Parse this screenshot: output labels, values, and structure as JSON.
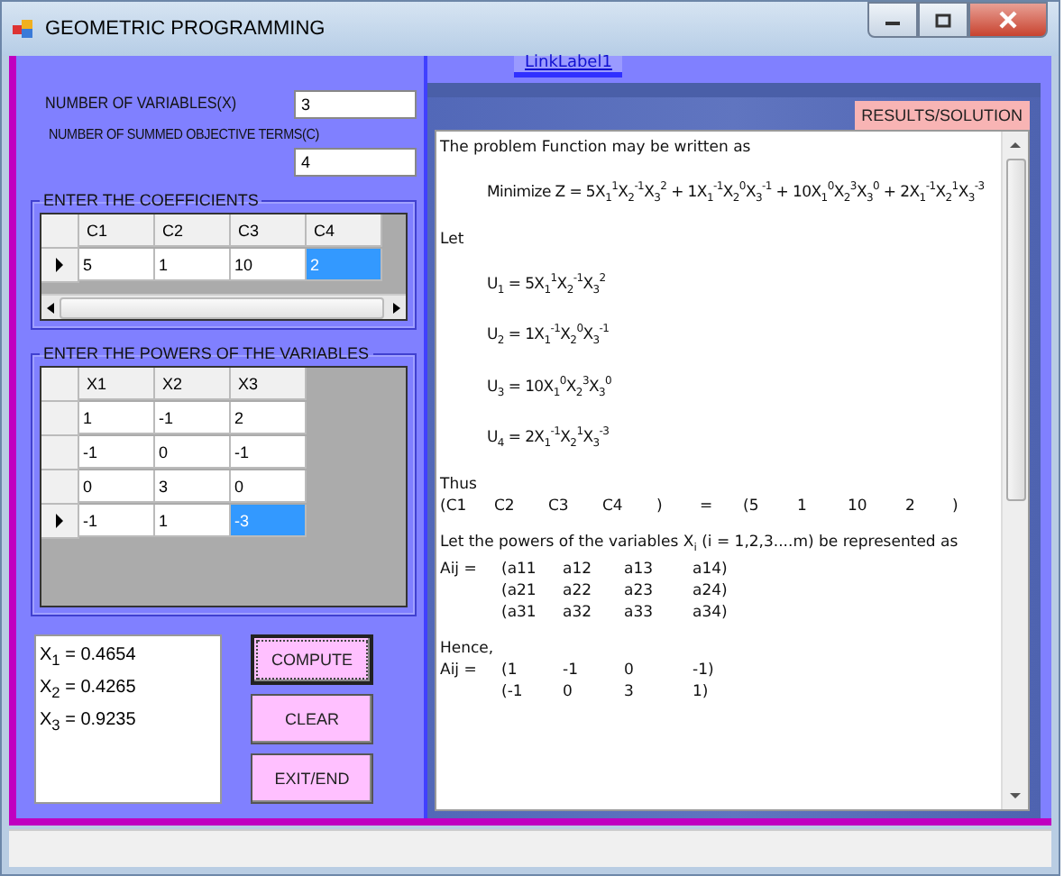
{
  "window": {
    "title": "GEOMETRIC PROGRAMMING"
  },
  "inputs": [
    {
      "label": "NUMBER OF VARIABLES(X)",
      "value": "3",
      "kind": "inline"
    },
    {
      "label": "NUMBER OF SUMMED OBJECTIVE TERMS(C)",
      "value": "4",
      "kind": "stacked"
    }
  ],
  "coefficients": {
    "title": "ENTER THE COEFFICIENTS",
    "columns": [
      "C1",
      "C2",
      "C3",
      "C4"
    ],
    "rows": [
      {
        "current": true,
        "cells": [
          {
            "value": "5",
            "selected": false
          },
          {
            "value": "1",
            "selected": false
          },
          {
            "value": "10",
            "selected": false
          },
          {
            "value": "2",
            "selected": true
          }
        ]
      }
    ]
  },
  "powers": {
    "title": "ENTER THE POWERS OF THE VARIABLES",
    "columns": [
      "X1",
      "X2",
      "X3"
    ],
    "rows": [
      {
        "current": false,
        "cells": [
          {
            "value": "1",
            "selected": false
          },
          {
            "value": "-1",
            "selected": false
          },
          {
            "value": "2",
            "selected": false
          }
        ]
      },
      {
        "current": false,
        "cells": [
          {
            "value": "-1",
            "selected": false
          },
          {
            "value": "0",
            "selected": false
          },
          {
            "value": "-1",
            "selected": false
          }
        ]
      },
      {
        "current": false,
        "cells": [
          {
            "value": "0",
            "selected": false
          },
          {
            "value": "3",
            "selected": false
          },
          {
            "value": "0",
            "selected": false
          }
        ]
      },
      {
        "current": true,
        "cells": [
          {
            "value": "-1",
            "selected": false
          },
          {
            "value": "1",
            "selected": false
          },
          {
            "value": "-3",
            "selected": true
          }
        ]
      }
    ]
  },
  "solution": [
    "X$_{1}$ = 0.4654",
    "X$_{2}$ = 0.4265",
    "X$_{3}$ = 0.9235"
  ],
  "buttons": [
    {
      "label": "COMPUTE",
      "focused": true
    },
    {
      "label": "CLEAR",
      "focused": false
    },
    {
      "label": "EXIT/END",
      "focused": false
    }
  ],
  "link": "LinkLabel1",
  "results": {
    "title": "RESULTS/SOLUTION",
    "lines": [
      {
        "kind": "para",
        "text": "The problem Function may be written as"
      },
      {
        "kind": "formula",
        "text": "Minimize Z = 5X$_{1}$$^{1}$X$_{2}$$^{-1}$X$_{3}$$^{2}$ + 1X$_{1}$$^{-1}$X$_{2}$$^{0}$X$_{3}$$^{-1}$ + 10X$_{1}$$^{0}$X$_{2}$$^{3}$X$_{3}$$^{0}$ + 2X$_{1}$$^{-1}$X$_{2}$$^{1}$X$_{3}$$^{-3}$"
      },
      {
        "kind": "para",
        "text": "Let"
      },
      {
        "kind": "formula",
        "text": "U$_{1}$ = 5X$_{1}$$^{1}$X$_{2}$$^{-1}$X$_{3}$$^{2}$"
      },
      {
        "kind": "formula",
        "text": "U$_{2}$ = 1X$_{1}$$^{-1}$X$_{2}$$^{0}$X$_{3}$$^{-1}$"
      },
      {
        "kind": "formula",
        "text": "U$_{3}$ = 10X$_{1}$$^{0}$X$_{2}$$^{3}$X$_{3}$$^{0}$"
      },
      {
        "kind": "formula",
        "text": "U$_{4}$ = 2X$_{1}$$^{-1}$X$_{2}$$^{1}$X$_{3}$$^{-3}$"
      },
      {
        "kind": "para",
        "text": "Thus"
      },
      {
        "kind": "wide",
        "cells": [
          "(C1",
          "C2",
          "C3",
          "C4",
          ")",
          "=",
          "(5",
          "1",
          "10",
          "2",
          ")"
        ]
      },
      {
        "kind": "para",
        "text": "Let the powers of the variables X$_{i}$ (i = 1,2,3....m) be represented as"
      },
      {
        "kind": "row",
        "label": "Aij =",
        "cells": [
          "(a11",
          "a12",
          "a13",
          "a14)"
        ]
      },
      {
        "kind": "row",
        "cells": [
          "(a21",
          "a22",
          "a23",
          "a24)"
        ]
      },
      {
        "kind": "row",
        "cells": [
          "(a31",
          "a32",
          "a33",
          "a34)"
        ]
      },
      {
        "kind": "para",
        "text": "Hence,"
      },
      {
        "kind": "row",
        "label": "Aij =",
        "cells": [
          "(1",
          "-1",
          "0",
          "-1)"
        ]
      },
      {
        "kind": "row",
        "cells": [
          "(-1",
          "0",
          "3",
          "1)"
        ]
      }
    ]
  }
}
